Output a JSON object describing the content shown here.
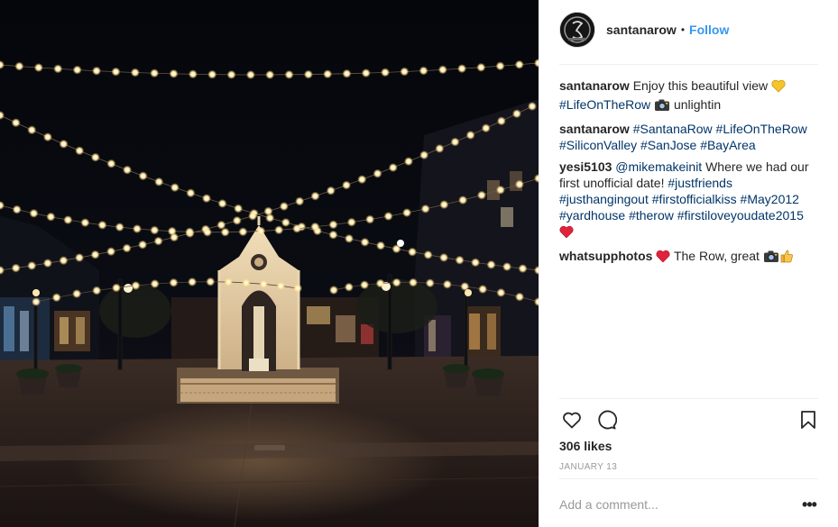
{
  "post": {
    "username": "santanarow",
    "follow_label": "Follow",
    "dot": "•",
    "likes": "306 likes",
    "date": "JANUARY 13",
    "add_comment_placeholder": "Add a comment...",
    "more_label": "•••"
  },
  "comments": [
    {
      "user": "santanarow",
      "parts": [
        {
          "t": "text",
          "v": " Enjoy this beautiful view "
        },
        {
          "t": "emoji",
          "v": "yellow-heart"
        },
        {
          "t": "text",
          "v": " "
        },
        {
          "t": "tag",
          "v": "#LifeOnTheRow"
        },
        {
          "t": "text",
          "v": " "
        },
        {
          "t": "emoji",
          "v": "camera"
        },
        {
          "t": "text",
          "v": " unlightin"
        }
      ]
    },
    {
      "user": "santanarow",
      "parts": [
        {
          "t": "text",
          "v": " "
        },
        {
          "t": "tag",
          "v": "#SantanaRow"
        },
        {
          "t": "text",
          "v": " "
        },
        {
          "t": "tag",
          "v": "#LifeOnTheRow"
        },
        {
          "t": "text",
          "v": " "
        },
        {
          "t": "tag",
          "v": "#SiliconValley"
        },
        {
          "t": "text",
          "v": " "
        },
        {
          "t": "tag",
          "v": "#SanJose"
        },
        {
          "t": "text",
          "v": " "
        },
        {
          "t": "tag",
          "v": "#BayArea"
        }
      ]
    },
    {
      "user": "yesi5103",
      "parts": [
        {
          "t": "text",
          "v": " "
        },
        {
          "t": "tag",
          "v": "@mikemakeinit"
        },
        {
          "t": "text",
          "v": " Where we had our first unofficial date! "
        },
        {
          "t": "tag",
          "v": "#justfriends"
        },
        {
          "t": "text",
          "v": " "
        },
        {
          "t": "tag",
          "v": "#justhangingout"
        },
        {
          "t": "text",
          "v": " "
        },
        {
          "t": "tag",
          "v": "#firstofficialkiss"
        },
        {
          "t": "text",
          "v": " "
        },
        {
          "t": "tag",
          "v": "#May2012"
        },
        {
          "t": "text",
          "v": " "
        },
        {
          "t": "tag",
          "v": "#yardhouse"
        },
        {
          "t": "text",
          "v": " "
        },
        {
          "t": "tag",
          "v": "#therow"
        },
        {
          "t": "text",
          "v": " "
        },
        {
          "t": "tag",
          "v": "#firstiloveyoudate2015"
        },
        {
          "t": "text",
          "v": " "
        },
        {
          "t": "emoji",
          "v": "red-heart"
        }
      ]
    },
    {
      "user": "whatsupphotos",
      "parts": [
        {
          "t": "text",
          "v": " "
        },
        {
          "t": "emoji",
          "v": "red-heart"
        },
        {
          "t": "text",
          "v": " The Row, great "
        },
        {
          "t": "emoji",
          "v": "camera"
        },
        {
          "t": "emoji",
          "v": "thumbs-up"
        }
      ]
    }
  ],
  "icons": {
    "like": "heart-outline-icon",
    "comment": "comment-bubble-icon",
    "save": "bookmark-icon",
    "more": "ellipsis-icon"
  },
  "colors": {
    "link": "#3897f0",
    "tag": "#003569",
    "muted": "#999999",
    "text": "#262626"
  }
}
